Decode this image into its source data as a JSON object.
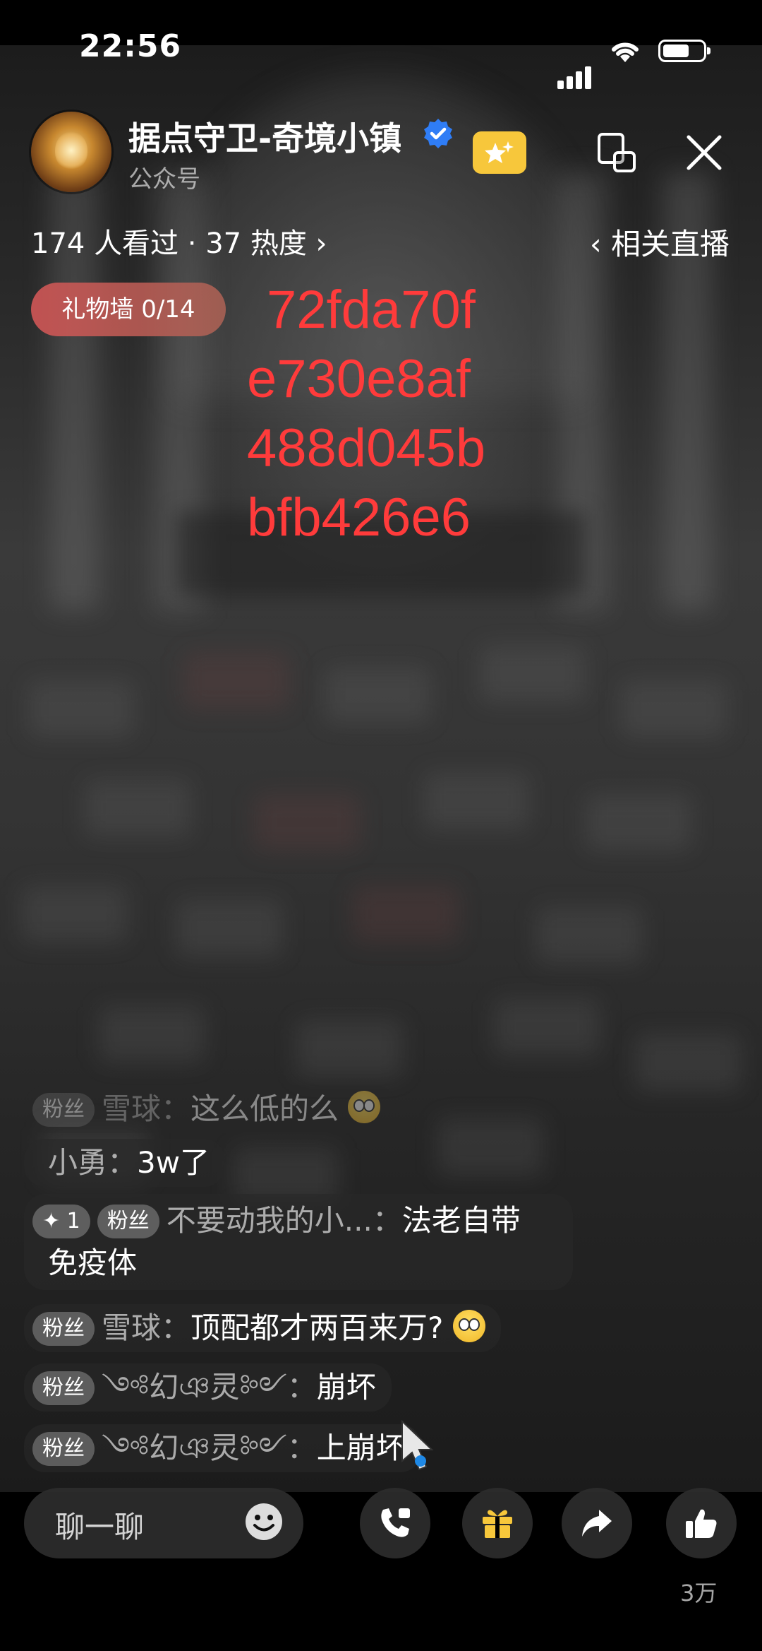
{
  "status_bar": {
    "time": "22:56"
  },
  "header": {
    "channel_name": "据点守卫-奇境小镇",
    "channel_type": "公众号",
    "stats": "174 人看过 · 37 热度 ›",
    "related_live": "‹ 相关直播"
  },
  "gift_wall": {
    "label": "礼物墙 0/14"
  },
  "overlay_code": [
    "72fda70f",
    "e730e8af",
    "488d045b",
    "bfb426e6"
  ],
  "comments": [
    {
      "tag": "粉丝",
      "name": "雪球：",
      "message": "这么低的么",
      "emoji": "flushed-emoji"
    },
    {
      "tag": "",
      "name": "小勇：",
      "message": "3w了"
    },
    {
      "level": "✦ 1",
      "tag": "粉丝",
      "name": "不要动我的小...：",
      "message": "法老自带",
      "message_line2": "免疫体"
    },
    {
      "tag": "粉丝",
      "name": "雪球：",
      "message": "顶配都才两百来万?",
      "emoji": "flushed-emoji"
    },
    {
      "tag": "粉丝",
      "name": "༺幻ঞ灵༻：",
      "message": "崩坏"
    },
    {
      "tag": "粉丝",
      "name": "༺幻ঞ灵༻：",
      "message": "上崩坏"
    }
  ],
  "bottom_bar": {
    "chat_placeholder": "聊一聊",
    "like_count": "3万"
  },
  "colors": {
    "overlay_code": "#ff3b3b",
    "gift_wall": "#cd5555",
    "badge": "#f7c73b",
    "verified": "#2f7df6"
  },
  "icons": [
    "signal-icon",
    "wifi-icon",
    "battery-icon",
    "verified-icon",
    "star-badge-icon",
    "picture-in-picture-icon",
    "close-icon",
    "smile-icon",
    "phone-call-icon",
    "gift-icon",
    "share-icon",
    "like-icon"
  ]
}
